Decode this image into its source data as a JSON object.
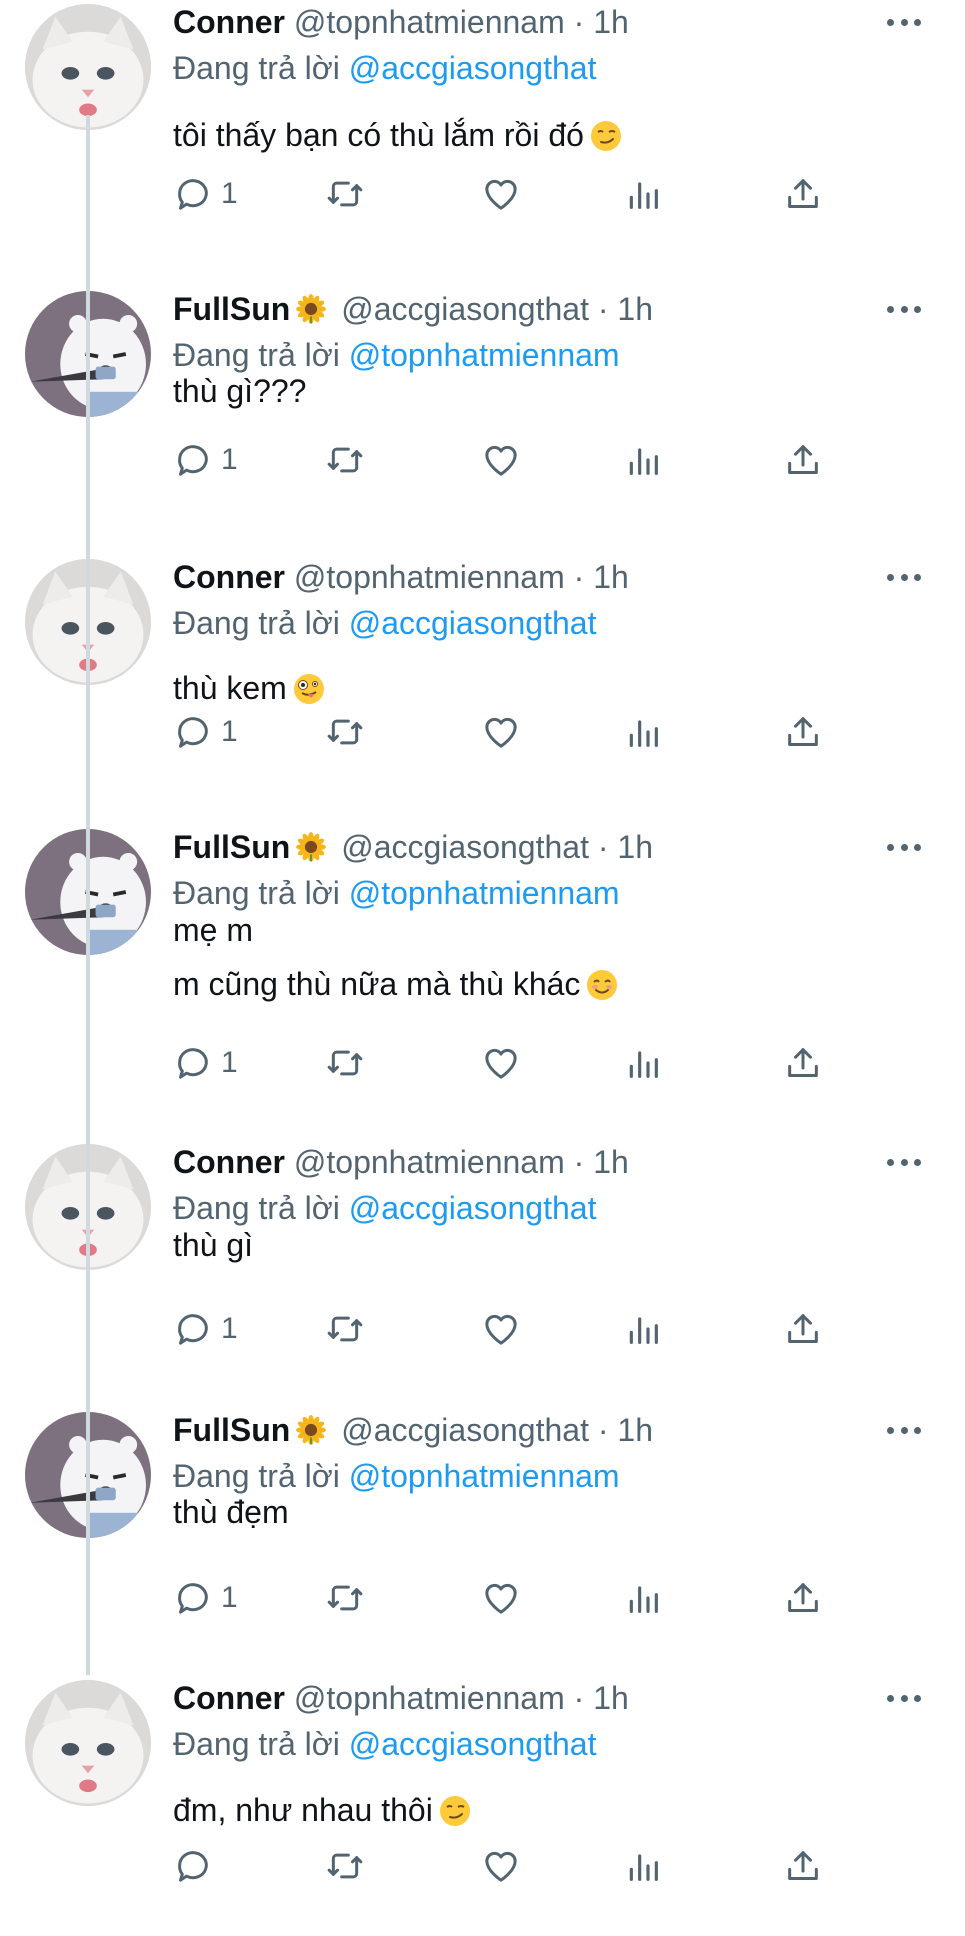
{
  "tweets": [
    {
      "name": "Conner",
      "handle": "@topnhatmiennam",
      "time": "1h",
      "reply_prefix": "Đang trả lời",
      "reply_to": "@accgiasongthat",
      "lines": [
        "tôi thấy bạn có thù lắm rồi đó"
      ],
      "emoji": "smirk",
      "reply_count": "1",
      "avatar": "white-cat"
    },
    {
      "name": "FullSun",
      "name_emoji": "sunflower",
      "handle": "@accgiasongthat",
      "time": "1h",
      "reply_prefix": "Đang trả lời",
      "reply_to": "@topnhatmiennam",
      "lines": [
        "thù gì???"
      ],
      "reply_count": "1",
      "avatar": "polar-bear-knife"
    },
    {
      "name": "Conner",
      "handle": "@topnhatmiennam",
      "time": "1h",
      "reply_prefix": "Đang trả lời",
      "reply_to": "@accgiasongthat",
      "lines": [
        "thù kem"
      ],
      "emoji": "zany-face",
      "reply_count": "1",
      "avatar": "white-cat"
    },
    {
      "name": "FullSun",
      "name_emoji": "sunflower",
      "handle": "@accgiasongthat",
      "time": "1h",
      "reply_prefix": "Đang trả lời",
      "reply_to": "@topnhatmiennam",
      "lines": [
        "mẹ m",
        "m cũng thù nữa mà thù khác"
      ],
      "emoji": "smiling-face",
      "reply_count": "1",
      "avatar": "polar-bear-knife"
    },
    {
      "name": "Conner",
      "handle": "@topnhatmiennam",
      "time": "1h",
      "reply_prefix": "Đang trả lời",
      "reply_to": "@accgiasongthat",
      "lines": [
        "thù gì"
      ],
      "reply_count": "1",
      "avatar": "white-cat"
    },
    {
      "name": "FullSun",
      "name_emoji": "sunflower",
      "handle": "@accgiasongthat",
      "time": "1h",
      "reply_prefix": "Đang trả lời",
      "reply_to": "@topnhatmiennam",
      "lines": [
        "thù đẹm"
      ],
      "reply_count": "1",
      "avatar": "polar-bear-knife"
    },
    {
      "name": "Conner",
      "handle": "@topnhatmiennam",
      "time": "1h",
      "reply_prefix": "Đang trả lời",
      "reply_to": "@accgiasongthat",
      "lines": [
        "đm, như nhau thôi"
      ],
      "emoji": "smirk",
      "reply_count": "",
      "avatar": "white-cat"
    }
  ],
  "separator": "·",
  "icons": {
    "reply": "reply-icon",
    "retweet": "retweet-icon",
    "like": "heart-icon",
    "views": "analytics-icon",
    "share": "share-icon",
    "more": "more-icon"
  },
  "colors": {
    "text": "#0f1419",
    "secondary": "#536471",
    "link": "#1d9bf0",
    "thread_line": "#cfd9de"
  }
}
